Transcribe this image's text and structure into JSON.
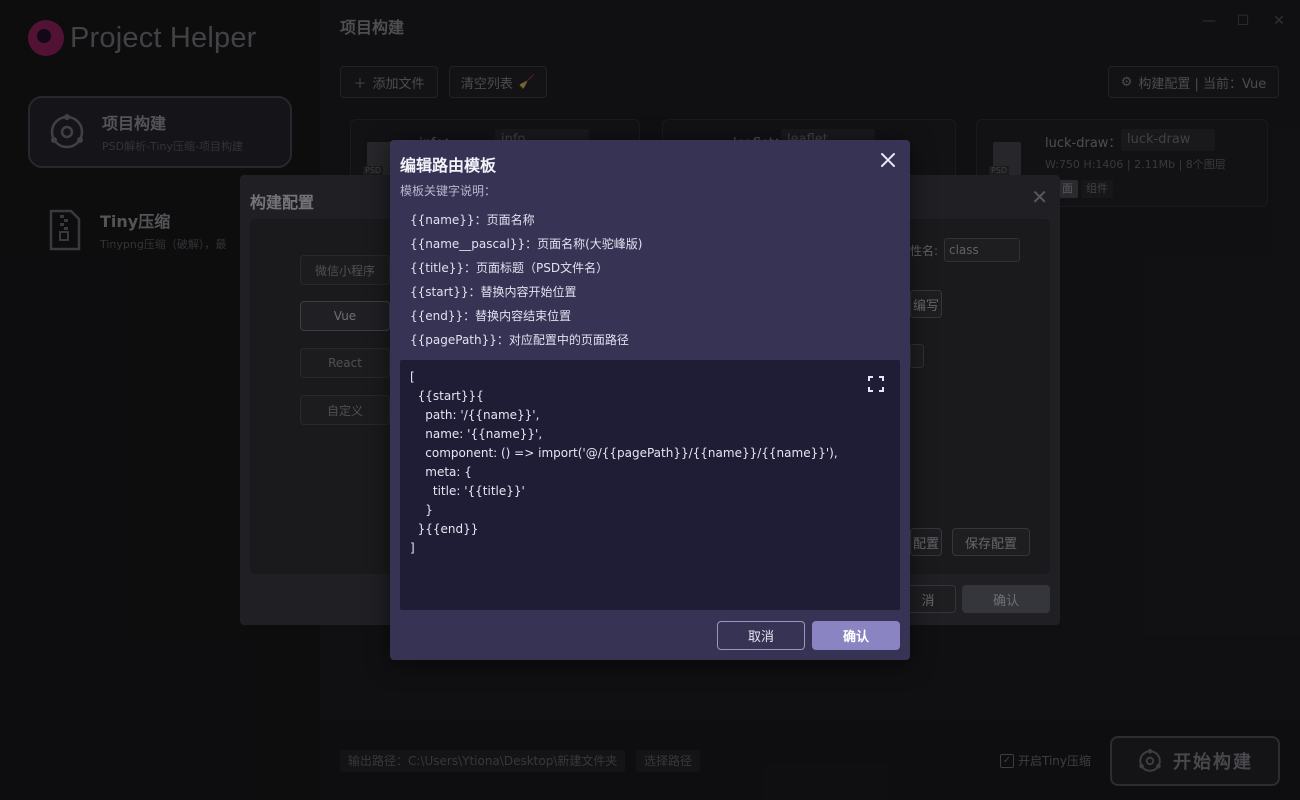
{
  "app": {
    "logo_text": "Project Helper"
  },
  "sidebar": {
    "items": [
      {
        "title": "项目构建",
        "subtitle": "PSD解析-Tiny压缩-项目构建",
        "icon": "build-icon"
      },
      {
        "title": "Tiny压缩",
        "subtitle": "Tinypng压缩（破解），最",
        "icon": "zip-file-icon"
      }
    ]
  },
  "main": {
    "title": "项目构建",
    "toolbar": {
      "add_file": "添加文件",
      "clear_list": "清空列表",
      "build_config": "构建配置 | 当前：Vue"
    },
    "files": [
      {
        "label": "info：",
        "name": "info",
        "meta": "",
        "tags": []
      },
      {
        "label": "leaflet：",
        "name": "leaflet",
        "meta": "",
        "tags": []
      },
      {
        "label": "luck-draw：",
        "name": "luck-draw",
        "meta": "W:750 H:1406 | 2.11Mb | 8个图层",
        "tags": [
          "面",
          "组件"
        ]
      }
    ]
  },
  "footer": {
    "output_path": "输出路径：C:\\Users\\Ytiona\\Desktop\\新建文件夹",
    "choose_path": "选择路径",
    "tiny_toggle": "开启Tiny压缩",
    "tiny_checked": true,
    "start_build": "开始构建"
  },
  "build_dialog": {
    "title": "构建配置",
    "frameworks": [
      "微信小程序",
      "Vue",
      "React",
      "自定义"
    ],
    "active_framework": "Vue",
    "class_label": "性名:",
    "class_value": "class",
    "write_btn": "编写",
    "reset_btn": "配置",
    "save_btn": "保存配置",
    "cancel": "消",
    "confirm": "确认"
  },
  "route_dialog": {
    "title": "编辑路由模板",
    "subtitle": "模板关键字说明：",
    "keywords": [
      "{{name}}：页面名称",
      "{{name__pascal}}：页面名称(大驼峰版)",
      "{{title}}：页面标题（PSD文件名）",
      "{{start}}：替换内容开始位置",
      "{{end}}：替换内容结束位置",
      "{{pagePath}}：对应配置中的页面路径"
    ],
    "code": "[\n  {{start}}{\n    path: '/{{name}}',\n    name: '{{name}}',\n    component: () => import('@/{{pagePath}}/{{name}}/{{name}}'),\n    meta: {\n      title: '{{title}}'\n    }\n  }{{end}}\n]",
    "cancel": "取消",
    "confirm": "确认"
  },
  "colors": {
    "dialog_bg": "#363355",
    "code_bg": "#1f1d36",
    "confirm_btn": "#8a85c2",
    "logo_accent": "#b0276e"
  }
}
